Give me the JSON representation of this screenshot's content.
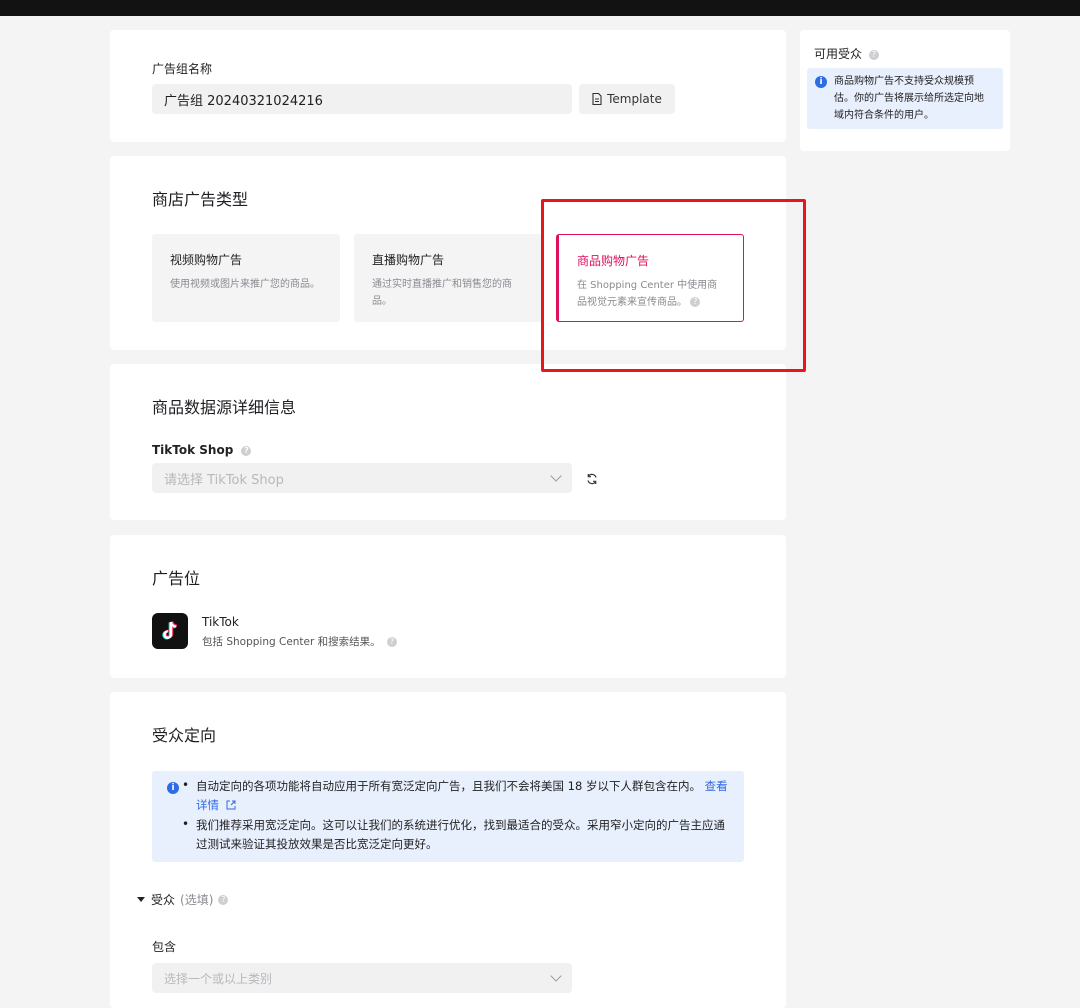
{
  "adgroup": {
    "name_label": "广告组名称",
    "name_value": "广告组 20240321024216",
    "template_button": "Template"
  },
  "store_ad_type": {
    "title": "商店广告类型",
    "options": [
      {
        "title": "视频购物广告",
        "desc": "使用视频或图片来推广您的商品。"
      },
      {
        "title": "直播购物广告",
        "desc": "通过实时直播推广和销售您的商品。"
      },
      {
        "title": "商品购物广告",
        "desc": "在 Shopping Center 中使用商品视觉元素来宣传商品。",
        "selected": true
      }
    ]
  },
  "product_source": {
    "title": "商品数据源详细信息",
    "shop_label": "TikTok Shop",
    "shop_placeholder": "请选择 TikTok Shop"
  },
  "placement": {
    "title": "广告位",
    "app_name": "TikTok",
    "app_desc": "包括 Shopping Center 和搜索结果。"
  },
  "audience": {
    "title": "受众定向",
    "notice_1": "自动定向的各项功能将自动应用于所有宽泛定向广告，且我们不会将美国 18 岁以下人群包含在内。",
    "notice_link": "查看详情",
    "notice_2": "我们推荐采用宽泛定向。这可以让我们的系统进行优化，找到最适合的受众。采用窄小定向的广告主应通过测试来验证其投放效果是否比宽泛定向更好。",
    "section_label": "受众",
    "section_optional": "(选填)",
    "include_label": "包含",
    "include_placeholder": "选择一个或以上类别"
  },
  "side_panel": {
    "title": "可用受众",
    "info": "商品购物广告不支持受众规模预估。你的广告将展示给所选定向地域内符合条件的用户。"
  },
  "colors": {
    "accent": "#e0105e",
    "highlight_box": "#e8161b",
    "info_blue": "#2e6be6"
  }
}
